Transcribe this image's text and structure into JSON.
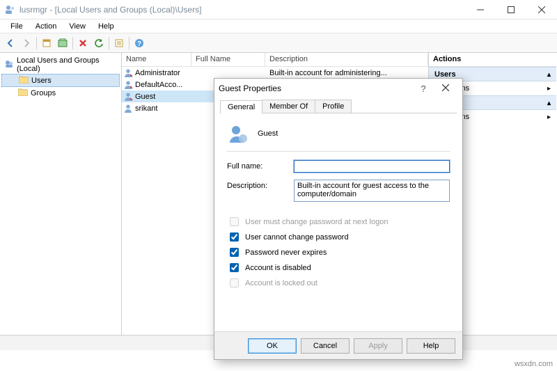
{
  "window": {
    "title": "lusrmgr - [Local Users and Groups (Local)\\Users]"
  },
  "menu": {
    "file": "File",
    "action": "Action",
    "view": "View",
    "help": "Help"
  },
  "tree": {
    "root": "Local Users and Groups (Local)",
    "users": "Users",
    "groups": "Groups"
  },
  "list": {
    "headers": {
      "name": "Name",
      "full": "Full Name",
      "desc": "Description"
    },
    "rows": [
      {
        "name": "Administrator",
        "full": "",
        "desc": "Built-in account for administering..."
      },
      {
        "name": "DefaultAcco...",
        "full": "",
        "desc": ""
      },
      {
        "name": "Guest",
        "full": "",
        "desc": ""
      },
      {
        "name": "srikant",
        "full": "",
        "desc": ""
      }
    ]
  },
  "actions": {
    "header": "Actions",
    "band1": "Users",
    "item1": "Actions",
    "item2": "Actions"
  },
  "dialog": {
    "title": "Guest Properties",
    "tabs": {
      "general": "General",
      "memberof": "Member Of",
      "profile": "Profile"
    },
    "identity": "Guest",
    "fullname_label": "Full name:",
    "fullname_value": "",
    "description_label": "Description:",
    "description_value": "Built-in account for guest access to the computer/domain",
    "check1": "User must change password at next logon",
    "check2": "User cannot change password",
    "check3": "Password never expires",
    "check4": "Account is disabled",
    "check5": "Account is locked out",
    "buttons": {
      "ok": "OK",
      "cancel": "Cancel",
      "apply": "Apply",
      "help": "Help"
    }
  },
  "watermark": "wsxdn.com"
}
